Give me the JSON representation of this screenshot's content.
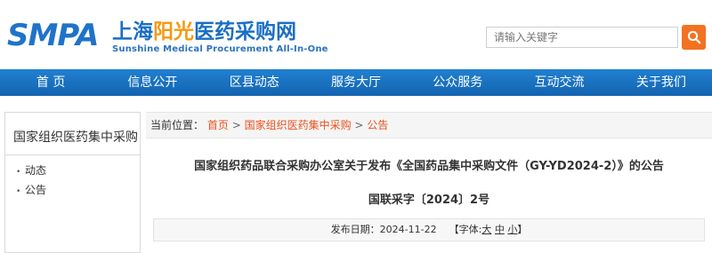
{
  "logo": {
    "abbr": "SMPA",
    "cn_part1": "上海",
    "cn_part2": "阳光",
    "cn_part3": "医药采购网",
    "en": "Sunshine Medical Procurement All-In-One"
  },
  "search": {
    "placeholder": "请输入关键字",
    "icon": "search-icon",
    "button_color": "#f37221"
  },
  "nav": {
    "items": [
      "首 页",
      "信息公开",
      "区县动态",
      "服务大厅",
      "公众服务",
      "互动交流",
      "关于我们"
    ],
    "color": "#1a72c2"
  },
  "sidebar": {
    "title": "国家组织医药集中采购",
    "items": [
      "动态",
      "公告"
    ]
  },
  "breadcrumb": {
    "label": "当前位置：",
    "items": [
      "首页",
      "国家组织医药集中采购",
      "公告"
    ],
    "separator": ">"
  },
  "article": {
    "title": "国家组织药品联合采购办公室关于发布《全国药品集中采购文件（GY-YD2024-2）》的公告",
    "doc_number": "国联采字〔2024〕2号",
    "publish_label": "发布日期：",
    "publish_date": "2024-11-22",
    "font_label_open": "【字体:",
    "font_large": "大",
    "font_medium": "中",
    "font_small": "小",
    "font_label_close": "】"
  }
}
